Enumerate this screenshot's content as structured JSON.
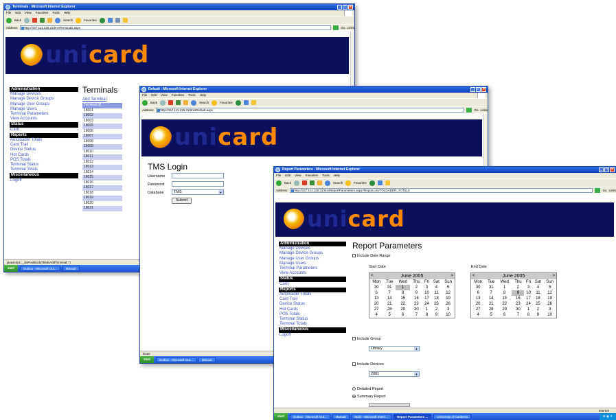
{
  "win1": {
    "title": "Terminals - Microsoft Internet Explorer",
    "menu": [
      "File",
      "Edit",
      "View",
      "Favorites",
      "Tools",
      "Help"
    ],
    "toolbar": {
      "back": "Back",
      "search": "Search",
      "favorites": "Favorites"
    },
    "address_label": "Address",
    "address": "http://157.111.129.31/tms/Terminals.aspx",
    "go": "Go",
    "links": "Links",
    "page_title": "Terminals",
    "add_link": "Add Terminal",
    "table_header": "Terminal ID",
    "rows": [
      "18001",
      "18002",
      "18003",
      "18005",
      "18006",
      "18007",
      "18008",
      "18009",
      "18010",
      "18011",
      "18012",
      "18013",
      "18014",
      "18015",
      "18016",
      "18017",
      "18018",
      "18019",
      "18020",
      "18021"
    ],
    "status": "javascript:__doPostBack('tblIdsAddTerminal','')",
    "taskbar": {
      "start": "start",
      "tasks": [
        "Outbox - Microsoft Out...",
        "Manual"
      ]
    }
  },
  "sidebar": {
    "admin_header": "Administration",
    "admin_items": [
      "Manage Devices",
      "Manage Device Groups",
      "Manage User Groups",
      "Manage Users",
      "Terminal Parameters",
      "View Accounts"
    ],
    "status_header": "Status",
    "status_items": [
      "Card"
    ],
    "reports_header": "Reports",
    "reports_items": [
      "Autoloader Totals",
      "Card Trail",
      "Device Status",
      "Hot Cards",
      "POS Totals",
      "Terminal Status",
      "Terminal Totals"
    ],
    "misc_header": "Miscellaneous",
    "misc_items": [
      "Logoff"
    ]
  },
  "logo": {
    "uni": "uni",
    "card": "card"
  },
  "win2": {
    "title": "Default - Microsoft Internet Explorer",
    "menu": [
      "File",
      "Edit",
      "View",
      "Favorites",
      "Tools",
      "Help"
    ],
    "address_label": "Address",
    "address": "http://157.111.129.31/tms/Default.aspx",
    "login_title": "TMS Login",
    "username_label": "Username",
    "password_label": "Password",
    "database_label": "Database",
    "database_value": "TMS",
    "submit": "Submit",
    "status": "Done",
    "taskbar": {
      "start": "start",
      "tasks": [
        "Outbox - Microsoft Out...",
        "Manual"
      ]
    }
  },
  "win3": {
    "title": "Report Parameters - Microsoft Internet Explorer",
    "menu": [
      "File",
      "Edit",
      "View",
      "Favorites",
      "Tools",
      "Help"
    ],
    "address_label": "Address",
    "address": "http://157.111.129.31/tms/ReportParameters.aspx?Report=AUTOLOADER_TOTALS",
    "page_title": "Report Parameters",
    "include_date_range": "Include Date Range",
    "start_date": "Start Date",
    "end_date": "End Date",
    "cal_month": "June 2005",
    "cal_prev": "<",
    "cal_next": ">",
    "cal_days": [
      "Mon",
      "Tue",
      "Wed",
      "Thu",
      "Fri",
      "Sat",
      "Sun"
    ],
    "cal_weeks": [
      [
        "30",
        "31",
        "1",
        "2",
        "3",
        "4",
        "5"
      ],
      [
        "6",
        "7",
        "8",
        "9",
        "10",
        "11",
        "12"
      ],
      [
        "13",
        "14",
        "15",
        "16",
        "17",
        "18",
        "19"
      ],
      [
        "20",
        "21",
        "22",
        "23",
        "24",
        "25",
        "26"
      ],
      [
        "27",
        "28",
        "29",
        "30",
        "1",
        "2",
        "3"
      ],
      [
        "4",
        "5",
        "6",
        "7",
        "8",
        "9",
        "10"
      ]
    ],
    "start_selected": "1",
    "end_selected": "9",
    "include_group": "Include Group",
    "group_value": "Library",
    "include_devices": "Include Devices",
    "devices_value": "2001",
    "detailed": "Detailed Report",
    "summary": "Summary Report",
    "taskbar": {
      "start": "start",
      "tasks": [
        "Outbox - Microsoft Out...",
        "Manual",
        "Main - Microsoft Intern...",
        "Report Parameters ...",
        "University of Canberra"
      ],
      "tray": "Internet"
    }
  }
}
